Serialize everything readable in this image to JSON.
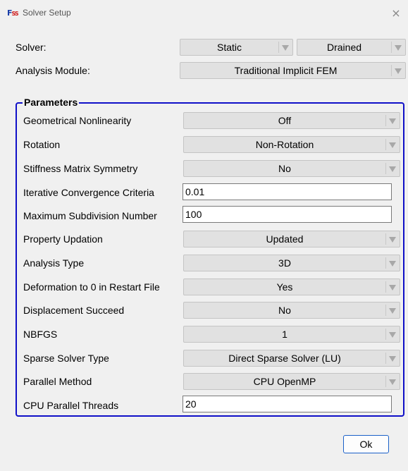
{
  "window": {
    "title": "Solver Setup",
    "close_symbol": "×",
    "icon_f": "F",
    "icon_s": "SS"
  },
  "solver": {
    "label": "Solver:",
    "type_value": "Static",
    "drainage_value": "Drained"
  },
  "analysis_module": {
    "label": "Analysis Module:",
    "value": "Traditional Implicit FEM"
  },
  "parameters": {
    "legend": "Parameters",
    "rows": [
      {
        "label": "Geometrical Nonlinearity",
        "value": "Off"
      },
      {
        "label": "Rotation",
        "value": "Non-Rotation"
      },
      {
        "label": "Stiffness Matrix Symmetry",
        "value": "No"
      },
      {
        "label": "Iterative Convergence Criteria",
        "value": "0.01"
      },
      {
        "label": "Maximum Subdivision Number",
        "value": "100"
      },
      {
        "label": "Property Updation",
        "value": "Updated"
      },
      {
        "label": "Analysis Type",
        "value": "3D"
      },
      {
        "label": "Deformation to 0 in Restart File",
        "value": "Yes"
      },
      {
        "label": "Displacement Succeed",
        "value": "No"
      },
      {
        "label": "NBFGS",
        "value": "1"
      },
      {
        "label": "Sparse Solver Type",
        "value": "Direct Sparse Solver (LU)"
      },
      {
        "label": "Parallel Method",
        "value": "CPU OpenMP"
      },
      {
        "label": "CPU Parallel Threads",
        "value": "20"
      }
    ]
  },
  "ok_label": "Ok"
}
